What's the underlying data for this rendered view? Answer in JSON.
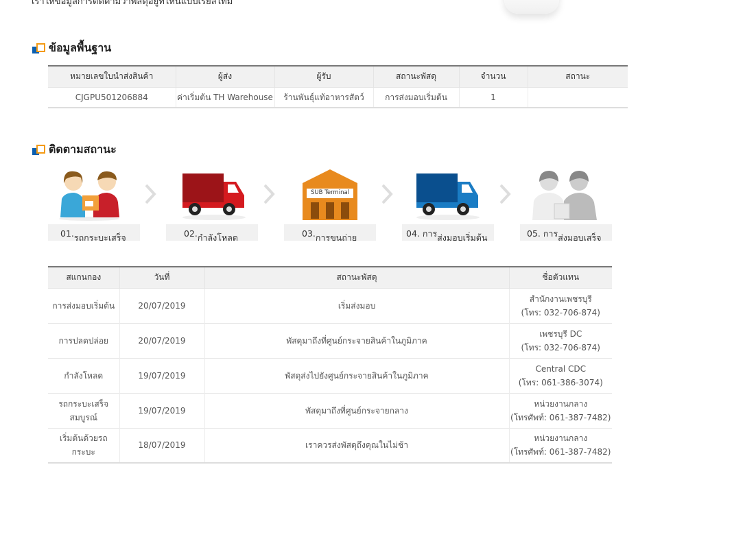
{
  "intro": "เราให้ข้อมูลการติดตามว่าพัสดุอยู่ที่ไหนแบบเรียลไทม์",
  "basic": {
    "title": "ข้อมูลพื้นฐาน",
    "headers": [
      "หมายเลขใบนำส่งสินค้า",
      "ผู้ส่ง",
      "ผู้รับ",
      "สถานะพัสดุ",
      "จำนวน",
      "สถานะ"
    ],
    "row": [
      "CJGPU501206884",
      "ค่าเริ่มต้น TH Warehouse",
      "ร้านพันธุ์แท้อาหารสัตว์",
      "การส่งมอบเริ่มต้น",
      "1",
      ""
    ]
  },
  "tracking": {
    "title": "ติดตามสถานะ",
    "steps": [
      {
        "num": "01.",
        "label": "รถกระบะเสร็จ"
      },
      {
        "num": "02.",
        "label": "กำลังโหลด"
      },
      {
        "num": "03.",
        "label": "การขนถ่าย"
      },
      {
        "num": "04. การ",
        "label": "ส่งมอบเริ่มต้น"
      },
      {
        "num": "05. การ",
        "label": "ส่งมอบเสร็จ"
      }
    ],
    "terminal_sign": "SUB Terminal",
    "headers": [
      "สแกนกอง",
      "วันที่",
      "สถานะพัสดุ",
      "ชื่อตัวแทน"
    ],
    "rows": [
      {
        "scan": "การส่งมอบเริ่มต้น",
        "date": "20/07/2019",
        "status": "เริ่มส่งมอบ",
        "agent": "สำนักงานเพชรบุรี",
        "phone": "(โทร: 032-706-874)"
      },
      {
        "scan": "การปลดปล่อย",
        "date": "20/07/2019",
        "status": "พัสดุมาถึงที่ศูนย์กระจายสินค้าในภูมิภาค",
        "agent": "เพชรบุรี DC",
        "phone": "(โทร: 032-706-874)"
      },
      {
        "scan": "กำลังโหลด",
        "date": "19/07/2019",
        "status": "พัสดุส่งไปยังศูนย์กระจายสินค้าในภูมิภาค",
        "agent": "Central CDC",
        "phone": "(โทร: 061-386-3074)"
      },
      {
        "scan": "รถกระบะเสร็จสมบูรณ์",
        "date": "19/07/2019",
        "status": "พัสดุมาถึงที่ศูนย์กระจายกลาง",
        "agent": "หน่วยงานกลาง",
        "phone": "(โทรศัพท์: 061-387-7482)"
      },
      {
        "scan": "เริ่มต้นด้วยรถกระบะ",
        "date": "18/07/2019",
        "status": "เราควรส่งพัสดุถึงคุณในไม่ช้า",
        "agent": "หน่วยงานกลาง",
        "phone": "(โทรศัพท์: 061-387-7482)"
      }
    ]
  }
}
